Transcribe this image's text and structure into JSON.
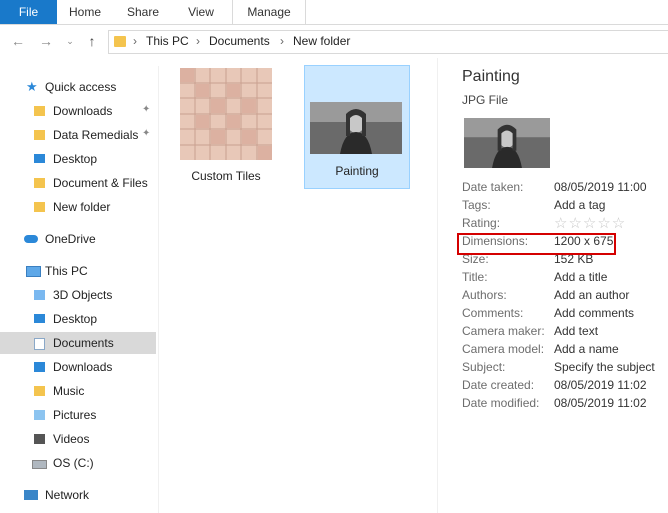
{
  "ribbon": {
    "tabs": [
      "File",
      "Home",
      "Share",
      "View",
      "Manage"
    ]
  },
  "address": {
    "crumbs": [
      "This PC",
      "Documents",
      "New folder"
    ],
    "separator": "›"
  },
  "nav": {
    "quick_access": "Quick access",
    "quick_items": [
      "Downloads",
      "Data Remedials",
      "Desktop",
      "Document & Files",
      "New folder"
    ],
    "onedrive": "OneDrive",
    "thispc": "This PC",
    "pc_items": [
      "3D Objects",
      "Desktop",
      "Documents",
      "Downloads",
      "Music",
      "Pictures",
      "Videos",
      "OS (C:)"
    ],
    "network": "Network"
  },
  "files": [
    {
      "name": "Custom Tiles",
      "icon": "tile-pattern-thumbnail"
    },
    {
      "name": "Painting",
      "icon": "mona-lisa-thumbnail"
    }
  ],
  "details": {
    "title": "Painting",
    "type": "JPG File",
    "props": [
      {
        "k": "Date taken:",
        "v": "08/05/2019 11:00"
      },
      {
        "k": "Tags:",
        "v": "Add a tag"
      },
      {
        "k": "Rating:",
        "v": ""
      },
      {
        "k": "Dimensions:",
        "v": "1200 x 675"
      },
      {
        "k": "Size:",
        "v": "152 KB"
      },
      {
        "k": "Title:",
        "v": "Add a title"
      },
      {
        "k": "Authors:",
        "v": "Add an author"
      },
      {
        "k": "Comments:",
        "v": "Add comments"
      },
      {
        "k": "Camera maker:",
        "v": "Add text"
      },
      {
        "k": "Camera model:",
        "v": "Add a name"
      },
      {
        "k": "Subject:",
        "v": "Specify the subject"
      },
      {
        "k": "Date created:",
        "v": "08/05/2019 11:02"
      },
      {
        "k": "Date modified:",
        "v": "08/05/2019 11:02"
      }
    ],
    "rating_stars": "☆☆☆☆☆"
  },
  "colors": {
    "file_tab": "#1979ca",
    "selection": "#cce8ff",
    "highlight_box": "#d40000"
  }
}
